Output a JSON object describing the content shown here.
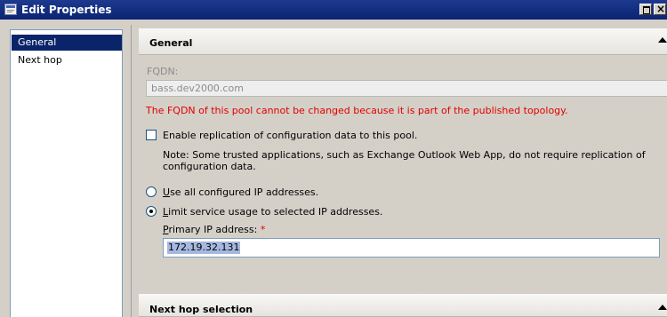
{
  "window": {
    "title": "Edit Properties",
    "icons": {
      "app": "properties-window-icon",
      "restore": "restore-icon",
      "close": "close-icon"
    }
  },
  "nav": {
    "items": [
      {
        "label": "General",
        "selected": true
      },
      {
        "label": "Next hop",
        "selected": false
      }
    ]
  },
  "general_section": {
    "header": "General",
    "fqdn_label": "FQDN:",
    "fqdn_value": "bass.dev2000.com",
    "fqdn_warning": "The FQDN of this pool cannot be changed because it is part of the published topology.",
    "replication_checkbox_label": "Enable replication of configuration data to this pool.",
    "replication_checked": false,
    "replication_note": "Note: Some trusted applications, such as Exchange Outlook Web App, do not require replication of configuration data.",
    "ip_options": [
      {
        "mnemonic": "U",
        "rest": "se all configured IP addresses.",
        "checked": false
      },
      {
        "mnemonic": "L",
        "rest": "imit service usage to selected IP addresses.",
        "checked": true
      }
    ],
    "primary_ip_mnemonic": "P",
    "primary_ip_label_rest": "rimary IP address:",
    "required_marker": "*",
    "primary_ip_value": "172.19.32.131"
  },
  "nexthop_section": {
    "header": "Next hop selection"
  },
  "colors": {
    "title_bar": "#0b2472",
    "selection": "#0a246a",
    "warning": "#e00000"
  }
}
